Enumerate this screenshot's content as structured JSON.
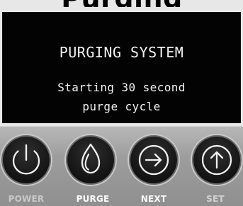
{
  "header": {
    "partial_title": "Purging"
  },
  "screen": {
    "title": "PURGING SYSTEM",
    "line1": "Starting 30 second",
    "line2": "purge cycle"
  },
  "controls": {
    "power_label": "POWER",
    "purge_label": "PURGE",
    "next_label": "NEXT",
    "set_label": "SET"
  },
  "icons": {
    "power": "power-icon",
    "purge": "water-drop-icon",
    "next": "arrow-right-icon",
    "set": "arrow-up-icon"
  },
  "colors": {
    "screen_background": "#030303",
    "screen_text": "#f2f2f2",
    "control_panel": "#a0a0a0",
    "button_face": "#151515",
    "label_text": "#fafafa"
  }
}
